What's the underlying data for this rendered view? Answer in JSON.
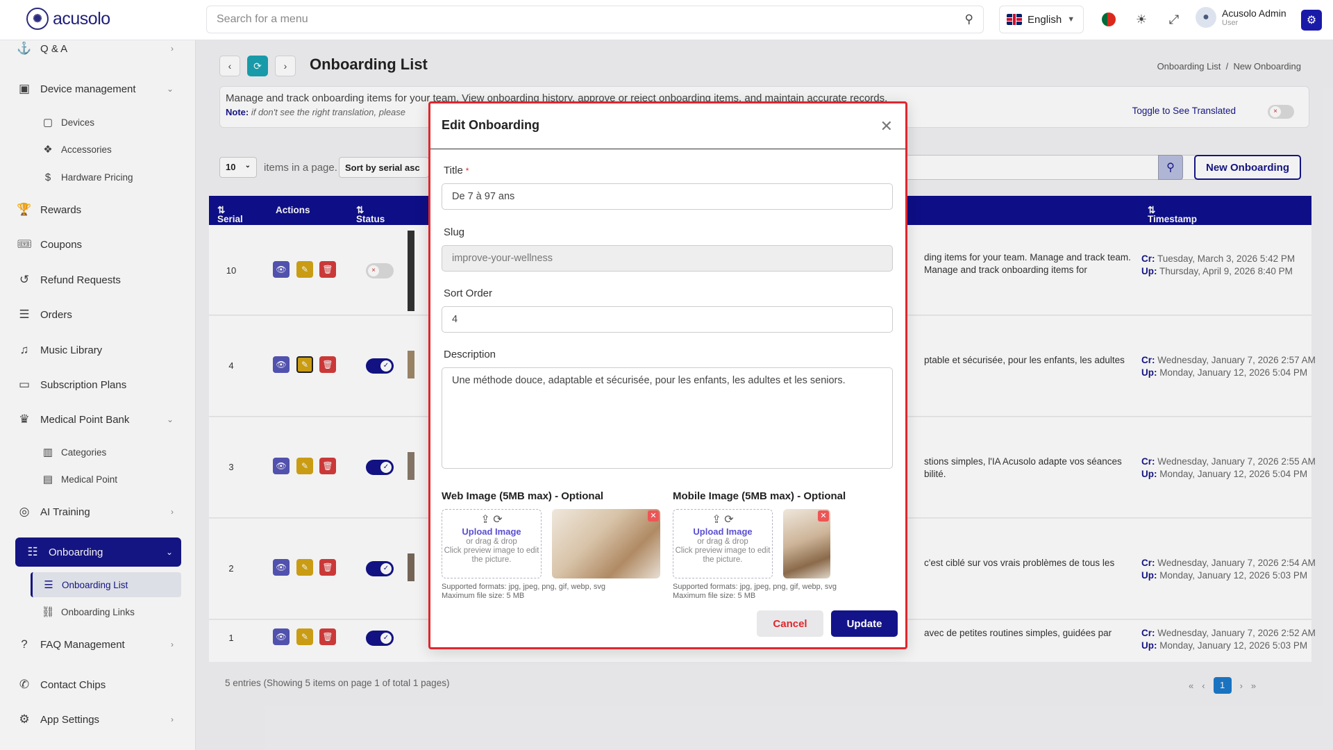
{
  "app": {
    "name": "acusolo"
  },
  "search": {
    "placeholder": "Search for a menu"
  },
  "language": {
    "selected": "English"
  },
  "user": {
    "name": "Acusolo Admin",
    "role": "User"
  },
  "sidebar": {
    "items": [
      {
        "label": "Q & A",
        "icon": "qa-icon"
      },
      {
        "label": "Device management",
        "icon": "device-icon"
      },
      {
        "label": "Devices",
        "icon": "devices-icon"
      },
      {
        "label": "Accessories",
        "icon": "accessories-icon"
      },
      {
        "label": "Hardware Pricing",
        "icon": "dollar-icon"
      },
      {
        "label": "Rewards",
        "icon": "trophy-icon"
      },
      {
        "label": "Coupons",
        "icon": "coupon-icon"
      },
      {
        "label": "Refund Requests",
        "icon": "refund-icon"
      },
      {
        "label": "Orders",
        "icon": "list-icon"
      },
      {
        "label": "Music Library",
        "icon": "music-icon"
      },
      {
        "label": "Subscription Plans",
        "icon": "plan-icon"
      },
      {
        "label": "Medical Point Bank",
        "icon": "bank-icon"
      },
      {
        "label": "Categories",
        "icon": "categories-icon"
      },
      {
        "label": "Medical Point",
        "icon": "medical-icon"
      },
      {
        "label": "AI Training",
        "icon": "ai-icon"
      },
      {
        "label": "Onboarding",
        "icon": "sliders-icon"
      },
      {
        "label": "Onboarding List",
        "icon": "list-icon"
      },
      {
        "label": "Onboarding Links",
        "icon": "link-icon"
      },
      {
        "label": "FAQ Management",
        "icon": "faq-icon"
      },
      {
        "label": "Contact Chips",
        "icon": "phone-icon"
      },
      {
        "label": "App Settings",
        "icon": "gear-icon"
      }
    ]
  },
  "page": {
    "title": "Onboarding List",
    "breadcrumb": [
      "Onboarding List",
      "/",
      "New Onboarding"
    ],
    "info": "Manage and track onboarding items for your team. View onboarding history, approve or reject onboarding items, and maintain accurate records.",
    "note_label": "Note:",
    "note_text": "if don't see the right translation, please",
    "toggle_label": "Toggle to See Translated"
  },
  "table": {
    "per_page": "10",
    "per_page_label": "items in a page.",
    "sort_label": "Sort by serial asc",
    "new_button": "New Onboarding",
    "headers": {
      "serial": "Serial",
      "actions": "Actions",
      "status": "Status",
      "timestamp": "Timestamp"
    },
    "rows": [
      {
        "serial": "10",
        "status": "off",
        "desc": "ding items for your team. Manage and track team. Manage and track onboarding items for",
        "cr": "Tuesday, March 3, 2026 5:42 PM",
        "up": "Thursday, April 9, 2026 8:40 PM"
      },
      {
        "serial": "4",
        "status": "on",
        "desc": "ptable et sécurisée, pour les enfants, les adultes",
        "cr": "Wednesday, January 7, 2026 2:57 AM",
        "up": "Monday, January 12, 2026 5:04 PM"
      },
      {
        "serial": "3",
        "status": "on",
        "desc": "stions simples, l'IA Acusolo adapte vos séances bilité.",
        "cr": "Wednesday, January 7, 2026 2:55 AM",
        "up": "Monday, January 12, 2026 5:04 PM"
      },
      {
        "serial": "2",
        "status": "on",
        "desc": "c'est ciblé sur vos vrais problèmes de tous les",
        "cr": "Wednesday, January 7, 2026 2:54 AM",
        "up": "Monday, January 12, 2026 5:03 PM"
      },
      {
        "serial": "1",
        "status": "on",
        "desc": "avec de petites routines simples, guidées par",
        "cr": "Wednesday, January 7, 2026 2:52 AM",
        "up": "Monday, January 12, 2026 5:03 PM"
      }
    ],
    "cr_label": "Cr:",
    "up_label": "Up:",
    "footer": "5 entries (Showing 5 items on page 1 of total 1 pages)",
    "current_page": "1"
  },
  "modal": {
    "title": "Edit Onboarding",
    "title_label": "Title",
    "title_value": "De 7 à 97 ans",
    "slug_label": "Slug",
    "slug_value": "improve-your-wellness",
    "sort_label": "Sort Order",
    "sort_value": "4",
    "desc_label": "Description",
    "desc_value": "Une méthode douce, adaptable et sécurisée, pour les enfants, les adultes et les seniors.",
    "web_label": "Web Image (5MB max) - Optional",
    "mobile_label": "Mobile Image (5MB max) - Optional",
    "upload_text": "Upload Image",
    "drag_text": "or drag & drop",
    "click_text": "Click preview image to edit the picture.",
    "formats": "Supported formats: jpg, jpeg, png, gif, webp, svg",
    "maxsize": "Maximum file size: 5 MB",
    "cancel": "Cancel",
    "update": "Update"
  }
}
